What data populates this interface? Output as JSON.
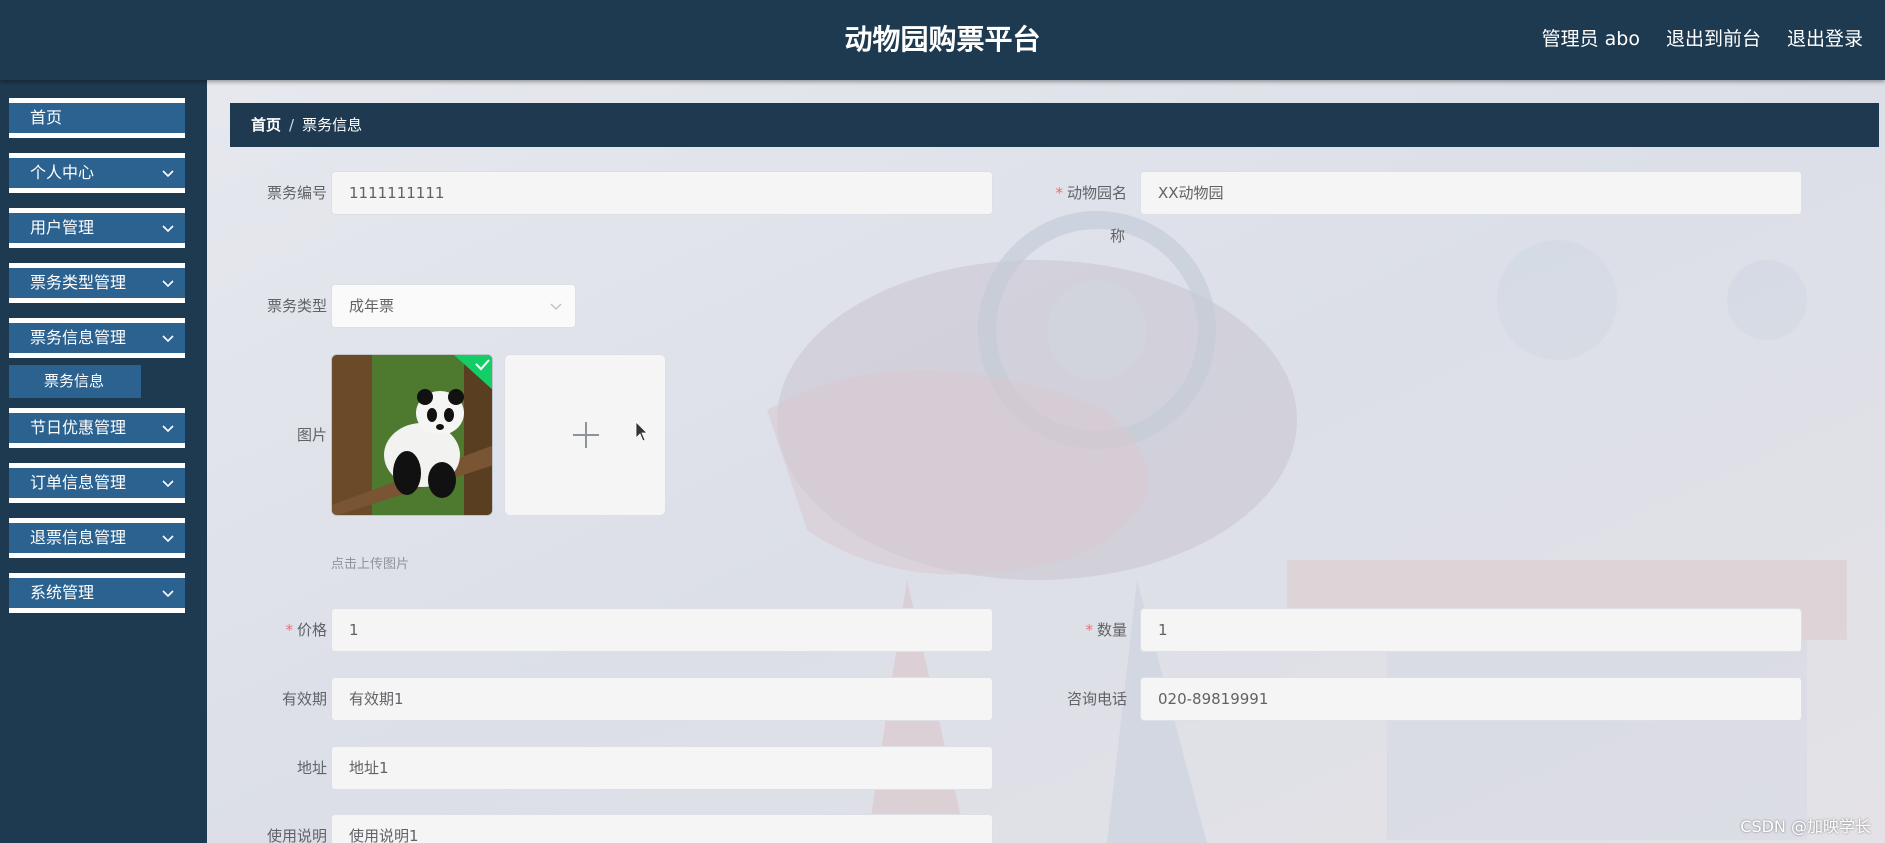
{
  "header": {
    "title": "动物园购票平台",
    "admin": "管理员 abo",
    "to_front": "退出到前台",
    "logout": "退出登录"
  },
  "sidebar": {
    "items": [
      {
        "label": "首页"
      },
      {
        "label": "个人中心"
      },
      {
        "label": "用户管理"
      },
      {
        "label": "票务类型管理"
      },
      {
        "label": "票务信息管理"
      },
      {
        "label": "节日优惠管理"
      },
      {
        "label": "订单信息管理"
      },
      {
        "label": "退票信息管理"
      },
      {
        "label": "系统管理"
      }
    ],
    "submenu": "票务信息"
  },
  "breadcrumb": {
    "home": "首页",
    "sep": "/",
    "current": "票务信息"
  },
  "form": {
    "ticket_no": {
      "label": "票务编号",
      "value": "1111111111"
    },
    "zoo_name": {
      "label": "动物园名",
      "label_line2": "称",
      "value": "XX动物园",
      "required": "*"
    },
    "ticket_type": {
      "label": "票务类型",
      "value": "成年票"
    },
    "image": {
      "label": "图片",
      "hint": "点击上传图片"
    },
    "price": {
      "label": "价格",
      "value": "1",
      "required": "*"
    },
    "quantity": {
      "label": "数量",
      "value": "1",
      "required": "*"
    },
    "validity": {
      "label": "有效期",
      "value": "有效期1"
    },
    "phone": {
      "label": "咨询电话",
      "value": "020-89819991"
    },
    "address": {
      "label": "地址",
      "value": "地址1"
    },
    "instructions": {
      "label": "使用说明",
      "value": "使用说明1"
    }
  },
  "watermark": "CSDN @加映学长",
  "colors": {
    "header": "#1e3a50",
    "menu": "#2b6290",
    "required": "#f56c6c",
    "upload_success": "#13ce66"
  }
}
